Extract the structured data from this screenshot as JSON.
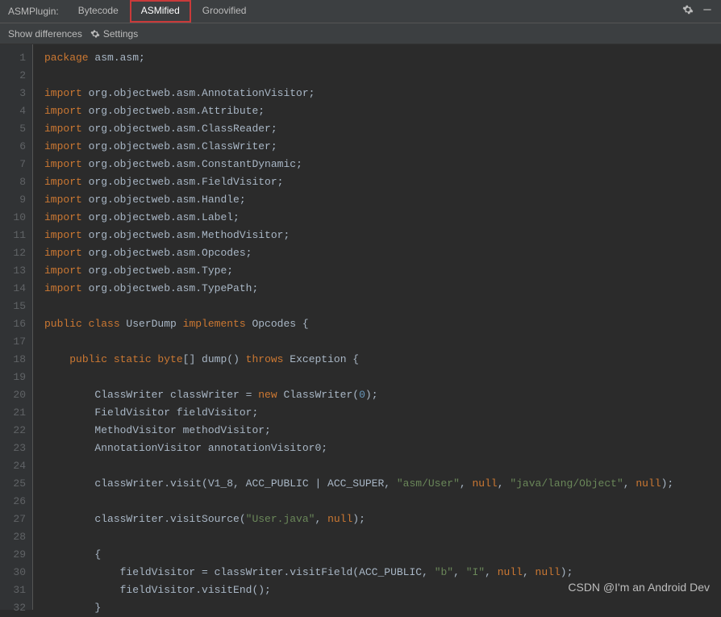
{
  "header": {
    "pluginLabel": "ASMPlugin:",
    "tabs": [
      {
        "label": "Bytecode",
        "active": false,
        "highlighted": false
      },
      {
        "label": "ASMified",
        "active": true,
        "highlighted": true
      },
      {
        "label": "Groovified",
        "active": false,
        "highlighted": false
      }
    ]
  },
  "secondary": {
    "showDiff": "Show differences",
    "settings": "Settings"
  },
  "code": {
    "lines": [
      [
        {
          "t": "package",
          "c": "k"
        },
        {
          "t": " asm.asm",
          "c": "c"
        },
        {
          "t": ";",
          "c": "p"
        }
      ],
      [],
      [
        {
          "t": "import",
          "c": "k"
        },
        {
          "t": " org.objectweb.asm.AnnotationVisitor",
          "c": "c"
        },
        {
          "t": ";",
          "c": "p"
        }
      ],
      [
        {
          "t": "import",
          "c": "k"
        },
        {
          "t": " org.objectweb.asm.Attribute",
          "c": "c"
        },
        {
          "t": ";",
          "c": "p"
        }
      ],
      [
        {
          "t": "import",
          "c": "k"
        },
        {
          "t": " org.objectweb.asm.ClassReader",
          "c": "c"
        },
        {
          "t": ";",
          "c": "p"
        }
      ],
      [
        {
          "t": "import",
          "c": "k"
        },
        {
          "t": " org.objectweb.asm.ClassWriter",
          "c": "c"
        },
        {
          "t": ";",
          "c": "p"
        }
      ],
      [
        {
          "t": "import",
          "c": "k"
        },
        {
          "t": " org.objectweb.asm.ConstantDynamic",
          "c": "c"
        },
        {
          "t": ";",
          "c": "p"
        }
      ],
      [
        {
          "t": "import",
          "c": "k"
        },
        {
          "t": " org.objectweb.asm.FieldVisitor",
          "c": "c"
        },
        {
          "t": ";",
          "c": "p"
        }
      ],
      [
        {
          "t": "import",
          "c": "k"
        },
        {
          "t": " org.objectweb.asm.Handle",
          "c": "c"
        },
        {
          "t": ";",
          "c": "p"
        }
      ],
      [
        {
          "t": "import",
          "c": "k"
        },
        {
          "t": " org.objectweb.asm.Label",
          "c": "c"
        },
        {
          "t": ";",
          "c": "p"
        }
      ],
      [
        {
          "t": "import",
          "c": "k"
        },
        {
          "t": " org.objectweb.asm.MethodVisitor",
          "c": "c"
        },
        {
          "t": ";",
          "c": "p"
        }
      ],
      [
        {
          "t": "import",
          "c": "k"
        },
        {
          "t": " org.objectweb.asm.Opcodes",
          "c": "c"
        },
        {
          "t": ";",
          "c": "p"
        }
      ],
      [
        {
          "t": "import",
          "c": "k"
        },
        {
          "t": " org.objectweb.asm.Type",
          "c": "c"
        },
        {
          "t": ";",
          "c": "p"
        }
      ],
      [
        {
          "t": "import",
          "c": "k"
        },
        {
          "t": " org.objectweb.asm.TypePath",
          "c": "c"
        },
        {
          "t": ";",
          "c": "p"
        }
      ],
      [],
      [
        {
          "t": "public class",
          "c": "k"
        },
        {
          "t": " UserDump ",
          "c": "c"
        },
        {
          "t": "implements",
          "c": "k"
        },
        {
          "t": " Opcodes {",
          "c": "c"
        }
      ],
      [],
      [
        {
          "t": "    ",
          "c": "c"
        },
        {
          "t": "public static byte",
          "c": "k"
        },
        {
          "t": "[] dump() ",
          "c": "c"
        },
        {
          "t": "throws",
          "c": "k"
        },
        {
          "t": " Exception {",
          "c": "c"
        }
      ],
      [],
      [
        {
          "t": "        ClassWriter classWriter = ",
          "c": "c"
        },
        {
          "t": "new",
          "c": "k"
        },
        {
          "t": " ClassWriter(",
          "c": "c"
        },
        {
          "t": "0",
          "c": "n"
        },
        {
          "t": ");",
          "c": "c"
        }
      ],
      [
        {
          "t": "        FieldVisitor fieldVisitor;",
          "c": "c"
        }
      ],
      [
        {
          "t": "        MethodVisitor methodVisitor;",
          "c": "c"
        }
      ],
      [
        {
          "t": "        AnnotationVisitor annotationVisitor0;",
          "c": "c"
        }
      ],
      [],
      [
        {
          "t": "        classWriter.visit(V1_8, ACC_PUBLIC | ACC_SUPER, ",
          "c": "c"
        },
        {
          "t": "\"asm/User\"",
          "c": "s"
        },
        {
          "t": ", ",
          "c": "c"
        },
        {
          "t": "null",
          "c": "k"
        },
        {
          "t": ", ",
          "c": "c"
        },
        {
          "t": "\"java/lang/Object\"",
          "c": "s"
        },
        {
          "t": ", ",
          "c": "c"
        },
        {
          "t": "null",
          "c": "k"
        },
        {
          "t": ");",
          "c": "c"
        }
      ],
      [],
      [
        {
          "t": "        classWriter.visitSource(",
          "c": "c"
        },
        {
          "t": "\"User.java\"",
          "c": "s"
        },
        {
          "t": ", ",
          "c": "c"
        },
        {
          "t": "null",
          "c": "k"
        },
        {
          "t": ");",
          "c": "c"
        }
      ],
      [],
      [
        {
          "t": "        {",
          "c": "c"
        }
      ],
      [
        {
          "t": "            fieldVisitor = classWriter.visitField(ACC_PUBLIC, ",
          "c": "c"
        },
        {
          "t": "\"b\"",
          "c": "s"
        },
        {
          "t": ", ",
          "c": "c"
        },
        {
          "t": "\"I\"",
          "c": "s"
        },
        {
          "t": ", ",
          "c": "c"
        },
        {
          "t": "null",
          "c": "k"
        },
        {
          "t": ", ",
          "c": "c"
        },
        {
          "t": "null",
          "c": "k"
        },
        {
          "t": ");",
          "c": "c"
        }
      ],
      [
        {
          "t": "            fieldVisitor.visitEnd();",
          "c": "c"
        }
      ],
      [
        {
          "t": "        }",
          "c": "c"
        }
      ]
    ]
  },
  "watermark": "CSDN @I'm an Android Dev"
}
